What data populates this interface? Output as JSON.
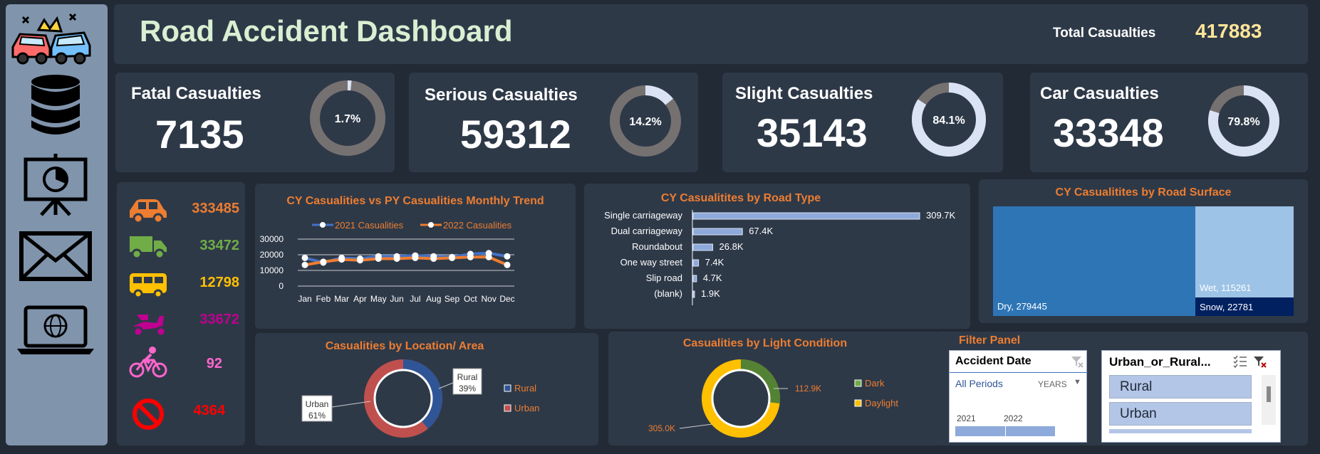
{
  "header": {
    "title": "Road Accident Dashboard",
    "total_label": "Total Casualties",
    "total_value": "417883"
  },
  "kpis": {
    "fatal": {
      "label": "Fatal Casualties",
      "value": "7135",
      "pct_label": "1.7%",
      "pct": 0.017
    },
    "serious": {
      "label": "Serious Casualties",
      "value": "59312",
      "pct_label": "14.2%",
      "pct": 0.142
    },
    "slight": {
      "label": "Slight Casualties",
      "value": "35143",
      "pct_label": "84.1%",
      "pct": 0.841
    },
    "car": {
      "label": "Car Casualties",
      "value": "33348",
      "pct_label": "79.8%",
      "pct": 0.798
    }
  },
  "vehicles": [
    {
      "icon": "car-icon",
      "value": "333485",
      "color": "#ed7d31"
    },
    {
      "icon": "truck-icon",
      "value": "33472",
      "color": "#70ad47"
    },
    {
      "icon": "bus-icon",
      "value": "12798",
      "color": "#ffc000"
    },
    {
      "icon": "scooter-icon",
      "value": "33672",
      "color": "#c00090"
    },
    {
      "icon": "bicycle-icon",
      "value": "92",
      "color": "#ff66cc"
    },
    {
      "icon": "no-entry-icon",
      "value": "4364",
      "color": "#ff0000"
    }
  ],
  "sidebar": {
    "icons": [
      "crash-logo-icon",
      "database-icon",
      "presentation-icon",
      "mail-icon",
      "laptop-globe-icon"
    ]
  },
  "colors": {
    "blue": "#4472c4",
    "orange": "#ed7d31",
    "ring_track": "#767171",
    "ring_fill": "#dae3f3"
  },
  "chart_data": [
    {
      "type": "line",
      "title": "CY Casualities vs PY Casualities Monthly Trend",
      "categories": [
        "Jan",
        "Feb",
        "Mar",
        "Apr",
        "May",
        "Jun",
        "Jul",
        "Aug",
        "Sep",
        "Oct",
        "Nov",
        "Dec"
      ],
      "series": [
        {
          "name": "2021 Casualities",
          "values": [
            18000,
            15000,
            18000,
            17500,
            19000,
            19000,
            19500,
            19000,
            18500,
            20500,
            21000,
            19000
          ]
        },
        {
          "name": "2022 Casualities",
          "values": [
            13500,
            15500,
            17000,
            16500,
            17500,
            17500,
            18000,
            17500,
            18000,
            18500,
            18500,
            13500
          ]
        }
      ],
      "yticks": [
        0,
        10000,
        20000,
        30000
      ],
      "ytick_labels": [
        "0",
        "10000",
        "20000",
        "30000"
      ],
      "ylim": [
        0,
        30000
      ],
      "legend": "top"
    },
    {
      "type": "bar",
      "title": "CY Casualitites by Road Type",
      "categories": [
        "Single carriageway",
        "Dual carriageway",
        "Roundabout",
        "One way street",
        "Slip road",
        "(blank)"
      ],
      "values": [
        309700,
        67400,
        26800,
        7400,
        4700,
        1900
      ],
      "data_labels": [
        "309.7K",
        "67.4K",
        "26.8K",
        "7.4K",
        "4.7K",
        "1.9K"
      ],
      "orientation": "horizontal"
    },
    {
      "type": "heatmap",
      "title": "CY Casualitites by Road Surface",
      "cells": [
        {
          "label": "Dry, 279445",
          "value": 279445
        },
        {
          "label": "Wet, 115261",
          "value": 115261
        },
        {
          "label": "Snow, 22781",
          "value": 22781
        }
      ]
    },
    {
      "type": "pie",
      "title": "Casualities by Location/ Area",
      "slices": [
        {
          "name": "Rural",
          "value": 39,
          "callout": [
            "Rural",
            "39%"
          ]
        },
        {
          "name": "Urban",
          "value": 61,
          "callout": [
            "Urban",
            "61%"
          ]
        }
      ],
      "legend": "right"
    },
    {
      "type": "pie",
      "title": "Casualities by Light Condition",
      "slices": [
        {
          "name": "Dark",
          "value": 112900,
          "label": "112.9K"
        },
        {
          "name": "Daylight",
          "value": 305000,
          "label": "305.0K"
        }
      ],
      "legend": "right"
    }
  ],
  "filter_panel": {
    "title": "Filter Panel",
    "date_slicer": {
      "title": "Accident Date",
      "period": "All Periods",
      "unit": "YEARS",
      "years": [
        "2021",
        "2022"
      ]
    },
    "area_slicer": {
      "title": "Urban_or_Rural...",
      "items": [
        "Rural",
        "Urban"
      ]
    }
  }
}
